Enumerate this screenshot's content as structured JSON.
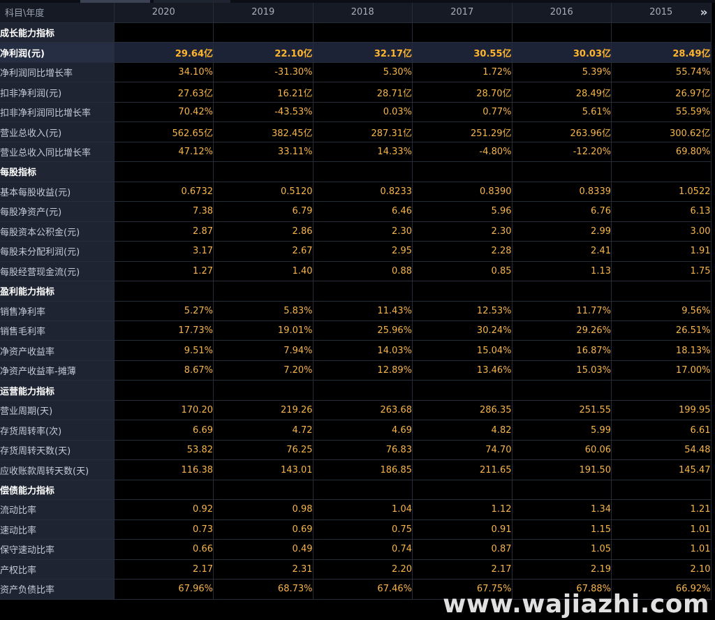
{
  "header": {
    "label": "科目\\年度",
    "years": [
      "2020",
      "2019",
      "2018",
      "2017",
      "2016",
      "2015"
    ],
    "more_icon": "double-chevron-right-icon"
  },
  "rows": [
    {
      "kind": "section",
      "label": "成长能力指标"
    },
    {
      "kind": "highlight",
      "label": "净利润(元)",
      "values": [
        "29.64亿",
        "22.10亿",
        "32.17亿",
        "30.55亿",
        "30.03亿",
        "28.49亿"
      ]
    },
    {
      "kind": "data",
      "label": "净利润同比增长率",
      "values": [
        "34.10%",
        "-31.30%",
        "5.30%",
        "1.72%",
        "5.39%",
        "55.74%"
      ]
    },
    {
      "kind": "data",
      "label": "扣非净利润(元)",
      "values": [
        "27.63亿",
        "16.21亿",
        "28.71亿",
        "28.70亿",
        "28.49亿",
        "26.97亿"
      ]
    },
    {
      "kind": "data",
      "label": "扣非净利润同比增长率",
      "values": [
        "70.42%",
        "-43.53%",
        "0.03%",
        "0.77%",
        "5.61%",
        "55.59%"
      ]
    },
    {
      "kind": "data",
      "label": "营业总收入(元)",
      "values": [
        "562.65亿",
        "382.45亿",
        "287.31亿",
        "251.29亿",
        "263.96亿",
        "300.62亿"
      ]
    },
    {
      "kind": "data",
      "label": "营业总收入同比增长率",
      "values": [
        "47.12%",
        "33.11%",
        "14.33%",
        "-4.80%",
        "-12.20%",
        "69.80%"
      ]
    },
    {
      "kind": "section",
      "label": "每股指标"
    },
    {
      "kind": "data",
      "label": "基本每股收益(元)",
      "values": [
        "0.6732",
        "0.5120",
        "0.8233",
        "0.8390",
        "0.8339",
        "1.0522"
      ]
    },
    {
      "kind": "data",
      "label": "每股净资产(元)",
      "values": [
        "7.38",
        "6.79",
        "6.46",
        "5.96",
        "6.76",
        "6.13"
      ]
    },
    {
      "kind": "data",
      "label": "每股资本公积金(元)",
      "values": [
        "2.87",
        "2.86",
        "2.30",
        "2.30",
        "2.99",
        "3.00"
      ]
    },
    {
      "kind": "data",
      "label": "每股未分配利润(元)",
      "values": [
        "3.17",
        "2.67",
        "2.95",
        "2.28",
        "2.41",
        "1.91"
      ]
    },
    {
      "kind": "data",
      "label": "每股经营现金流(元)",
      "values": [
        "1.27",
        "1.40",
        "0.88",
        "0.85",
        "1.13",
        "1.75"
      ]
    },
    {
      "kind": "section",
      "label": "盈利能力指标"
    },
    {
      "kind": "data",
      "label": "销售净利率",
      "values": [
        "5.27%",
        "5.83%",
        "11.43%",
        "12.53%",
        "11.77%",
        "9.56%"
      ]
    },
    {
      "kind": "data",
      "label": "销售毛利率",
      "values": [
        "17.73%",
        "19.01%",
        "25.96%",
        "30.24%",
        "29.26%",
        "26.51%"
      ]
    },
    {
      "kind": "data",
      "label": "净资产收益率",
      "values": [
        "9.51%",
        "7.94%",
        "14.03%",
        "15.04%",
        "16.87%",
        "18.13%"
      ]
    },
    {
      "kind": "data",
      "label": "净资产收益率-摊薄",
      "values": [
        "8.67%",
        "7.20%",
        "12.89%",
        "13.46%",
        "15.03%",
        "17.00%"
      ]
    },
    {
      "kind": "section",
      "label": "运营能力指标"
    },
    {
      "kind": "data",
      "label": "营业周期(天)",
      "values": [
        "170.20",
        "219.26",
        "263.68",
        "286.35",
        "251.55",
        "199.95"
      ]
    },
    {
      "kind": "data",
      "label": "存货周转率(次)",
      "values": [
        "6.69",
        "4.72",
        "4.69",
        "4.82",
        "5.99",
        "6.61"
      ]
    },
    {
      "kind": "data",
      "label": "存货周转天数(天)",
      "values": [
        "53.82",
        "76.25",
        "76.83",
        "74.70",
        "60.06",
        "54.48"
      ]
    },
    {
      "kind": "data",
      "label": "应收账款周转天数(天)",
      "values": [
        "116.38",
        "143.01",
        "186.85",
        "211.65",
        "191.50",
        "145.47"
      ]
    },
    {
      "kind": "section",
      "label": "偿债能力指标"
    },
    {
      "kind": "data",
      "label": "流动比率",
      "values": [
        "0.92",
        "0.98",
        "1.04",
        "1.12",
        "1.34",
        "1.21"
      ]
    },
    {
      "kind": "data",
      "label": "速动比率",
      "values": [
        "0.73",
        "0.69",
        "0.75",
        "0.91",
        "1.15",
        "1.01"
      ]
    },
    {
      "kind": "data",
      "label": "保守速动比率",
      "values": [
        "0.66",
        "0.49",
        "0.74",
        "0.87",
        "1.05",
        "1.01"
      ]
    },
    {
      "kind": "data",
      "label": "产权比率",
      "values": [
        "2.17",
        "2.31",
        "2.20",
        "2.17",
        "2.19",
        "2.10"
      ]
    },
    {
      "kind": "data",
      "label": "资产负债比率",
      "values": [
        "67.96%",
        "68.73%",
        "67.46%",
        "67.75%",
        "67.88%",
        "66.92%"
      ]
    }
  ],
  "watermark": "www.wajiazhi.com",
  "colors": {
    "value_text": "#f7b54a",
    "label_bg": "#1e2432",
    "header_bg": "#151a24",
    "grid": "#262c38"
  }
}
